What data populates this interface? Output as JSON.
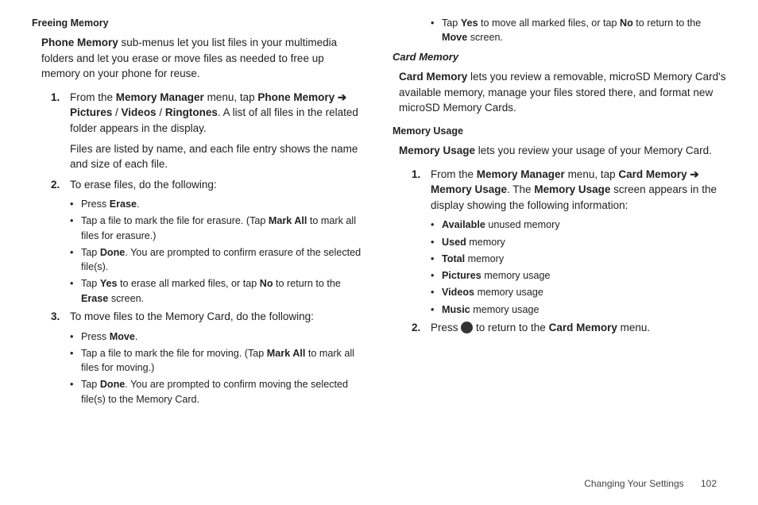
{
  "left": {
    "h_freeing": "Freeing Memory",
    "intro_pre": "Phone Memory",
    "intro_post": " sub-menus let you list files in your multimedia folders and let you erase or move files as needed to free up memory on your phone for reuse.",
    "step1_a": "From the ",
    "step1_b": "Memory Manager",
    "step1_c": " menu, tap ",
    "step1_d": "Phone Memory ➔ Pictures",
    "step1_e": " / ",
    "step1_f": "Videos",
    "step1_g": " / ",
    "step1_h": "Ringtones",
    "step1_i": ". A list of all files in the related folder appears in the display.",
    "step1_cont": "Files are listed by name, and each file entry shows the name and size of each file.",
    "step2": "To erase files, do the following:",
    "b2a_a": "Press ",
    "b2a_b": "Erase",
    "b2a_c": ".",
    "b2b_a": "Tap a file to mark the file for erasure. (Tap ",
    "b2b_b": "Mark All",
    "b2b_c": " to mark all files for erasure.)",
    "b2c_a": "Tap ",
    "b2c_b": "Done",
    "b2c_c": ". You are prompted to confirm erasure of the selected file(s).",
    "b2d_a": "Tap ",
    "b2d_b": "Yes",
    "b2d_c": " to erase all marked files, or tap ",
    "b2d_d": "No",
    "b2d_e": " to return to the ",
    "b2d_f": "Erase",
    "b2d_g": " screen.",
    "step3": "To move files to the Memory Card, do the following:",
    "b3a_a": "Press ",
    "b3a_b": "Move",
    "b3a_c": ".",
    "b3b_a": "Tap a file to mark the file for moving. (Tap ",
    "b3b_b": "Mark All",
    "b3b_c": " to mark all files for moving.)",
    "b3c_a": "Tap ",
    "b3c_b": "Done",
    "b3c_c": ". You are prompted to confirm moving the selected file(s) to the Memory Card."
  },
  "right": {
    "btop_a": "Tap ",
    "btop_b": "Yes",
    "btop_c": " to move all marked files, or tap ",
    "btop_d": "No",
    "btop_e": " to return to the ",
    "btop_f": "Move",
    "btop_g": " screen.",
    "h_card": "Card Memory",
    "card_intro_a": "Card Memory",
    "card_intro_b": " lets you review a removable, microSD Memory Card's available memory, manage your files stored there, and format new microSD Memory Cards.",
    "h_usage": "Memory Usage",
    "usage_intro_a": "Memory Usage",
    "usage_intro_b": " lets you review your usage of your Memory Card.",
    "u1_a": "From the ",
    "u1_b": "Memory Manager",
    "u1_c": " menu, tap ",
    "u1_d": "Card Memory ➔ Memory Usage",
    "u1_e": ". The ",
    "u1_f": "Memory Usage",
    "u1_g": " screen appears in the display showing the following information:",
    "ub1_a": "Available",
    "ub1_b": " unused memory",
    "ub2_a": "Used",
    "ub2_b": " memory",
    "ub3_a": "Total",
    "ub3_b": " memory",
    "ub4_a": "Pictures",
    "ub4_b": " memory usage",
    "ub5_a": "Videos",
    "ub5_b": " memory usage",
    "ub6_a": "Music",
    "ub6_b": " memory usage",
    "u2_a": "Press ",
    "u2_b": " to return to the ",
    "u2_c": "Card Memory",
    "u2_d": " menu."
  },
  "footer": {
    "section": "Changing Your Settings",
    "page": "102"
  }
}
